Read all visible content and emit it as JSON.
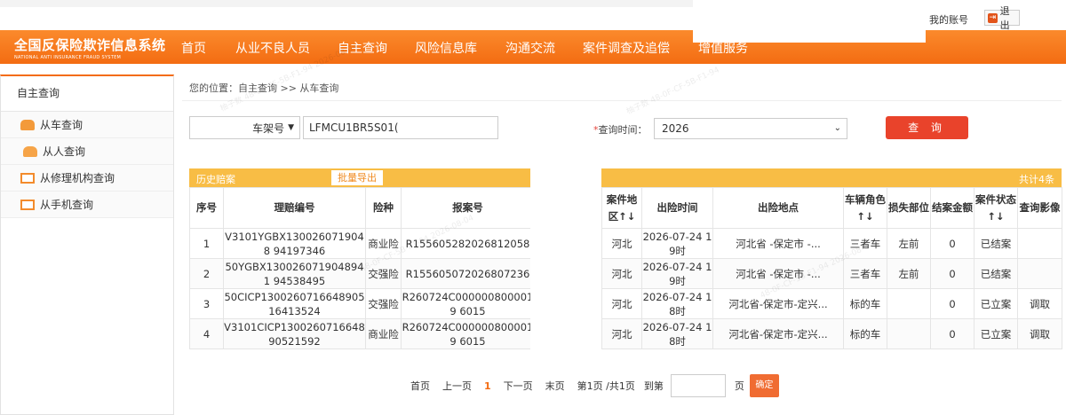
{
  "top": {
    "account": "我的账号",
    "logout": "退出"
  },
  "brand": {
    "cn": "全国反保险欺诈信息系统",
    "en": "NATIONAL ANTI INSURANCE FRAUD SYSTEM"
  },
  "nav": [
    "首页",
    "从业不良人员",
    "自主查询",
    "风险信息库",
    "沟通交流",
    "案件调查及追偿",
    "增值服务"
  ],
  "sidebar": {
    "title": "自主查询",
    "items": [
      "从车查询",
      "从人查询",
      "从修理机构查询",
      "从手机查询"
    ]
  },
  "breadcrumb": "您的位置：自主查询 >> 从车查询",
  "filter": {
    "type_value": "车架号",
    "vin_value": "LFMCU1BR5S01(",
    "time_label": "查询时间：",
    "year_value": "2026",
    "query_button": "查 询"
  },
  "table": {
    "section_title": "历史赔案",
    "export_button": "批量导出",
    "total": "共计4条",
    "headers": [
      "序号",
      "理赔编号",
      "险种",
      "报案号",
      "案件地区↑↓",
      "出险时间",
      "出险地点",
      "车辆角色↑↓",
      "损失部位",
      "结案金额",
      "案件状态↑↓",
      "查询影像"
    ],
    "rows": [
      [
        "1",
        "V3101YGBX1300260719048 94197346",
        "商业险",
        "R155605282026812058",
        "河北",
        "2026-07-24 19时",
        "河北省 -保定市 -...",
        "三者车",
        "左前",
        "0",
        "已结案",
        ""
      ],
      [
        "2",
        "50YGBX1300260719048941 94538495",
        "交强险",
        "R155605072026807236",
        "河北",
        "2026-07-24 19时",
        "河北省 -保定市 -...",
        "三者车",
        "左前",
        "0",
        "已结案",
        ""
      ],
      [
        "3",
        "50CICP1300260716648905 16413524",
        "交强险",
        "R260724C0000008000019 6015",
        "河北",
        "2026-07-24 18时",
        "河北省-保定市-定兴...",
        "标的车",
        "",
        "0",
        "已立案",
        "调取"
      ],
      [
        "4",
        "V3101CICP1300260716648 90521592",
        "商业险",
        "R260724C0000008000019 6015",
        "河北",
        "2026-07-24 18时",
        "河北省-保定市-定兴...",
        "标的车",
        "",
        "0",
        "已立案",
        "调取"
      ]
    ]
  },
  "pager": {
    "first": "首页",
    "prev": "上一页",
    "current": "1",
    "next": "下一页",
    "last": "末页",
    "info": "第1页 /共1页",
    "goto": "到第",
    "page_unit": "页",
    "ok": "确定"
  }
}
